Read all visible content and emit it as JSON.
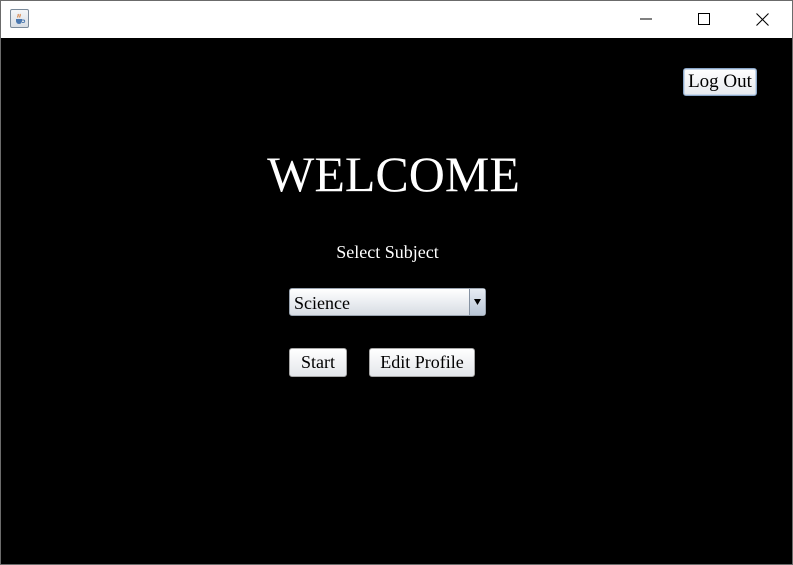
{
  "window": {
    "app_icon": "java-coffee-cup-icon",
    "controls": {
      "minimize_icon": "minimize-icon",
      "maximize_icon": "maximize-icon",
      "close_icon": "close-icon"
    }
  },
  "header": {
    "logout_label": "Log Out"
  },
  "main": {
    "title": "WELCOME",
    "subject_label": "Select Subject",
    "subject_select": {
      "selected": "Science",
      "arrow_icon": "dropdown-arrow-icon"
    },
    "start_label": "Start",
    "edit_profile_label": "Edit Profile"
  },
  "colors": {
    "background": "#000000",
    "text": "#ffffff",
    "titlebar": "#ffffff"
  }
}
